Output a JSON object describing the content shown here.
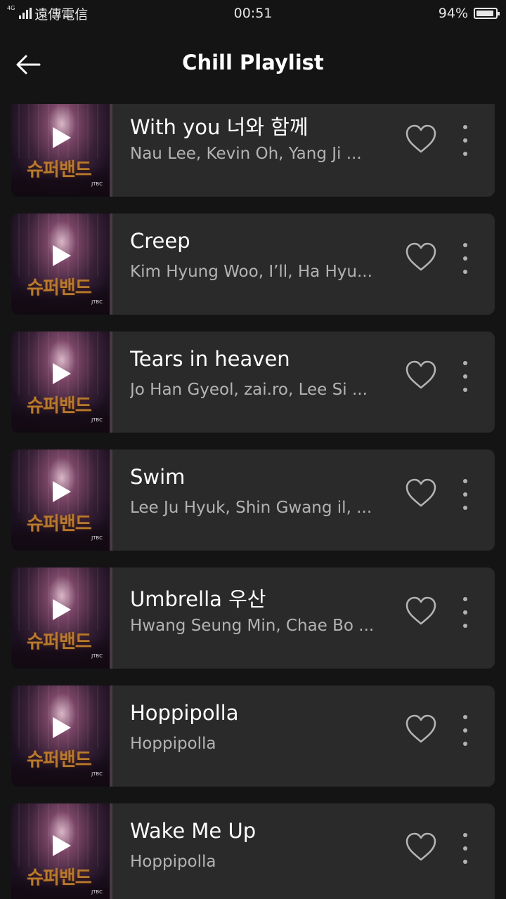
{
  "status_bar": {
    "network_tag": "4G",
    "carrier": "遠傳電信",
    "time": "00:51",
    "battery_percent": "94%",
    "battery_level": 0.94
  },
  "header": {
    "title": "Chill Playlist",
    "back_icon": "arrow-left-icon"
  },
  "cover_art": {
    "logo_text": "슈퍼밴드",
    "tag_text": "JTBC"
  },
  "tracks": [
    {
      "title": "With you 너와 함께",
      "artists": "Nau Lee, Kevin Oh, Yang Ji ..."
    },
    {
      "title": "Creep",
      "artists": "Kim Hyung Woo, I’ll, Ha Hyu..."
    },
    {
      "title": "Tears in heaven",
      "artists": "Jo Han Gyeol, zai.ro, Lee Si ..."
    },
    {
      "title": "Swim",
      "artists": "Lee Ju Hyuk, Shin Gwang il, ..."
    },
    {
      "title": "Umbrella 우산",
      "artists": "Hwang Seung Min, Chae Bo ..."
    },
    {
      "title": "Hoppipolla",
      "artists": "Hoppipolla"
    },
    {
      "title": "Wake Me Up",
      "artists": "Hoppipolla"
    }
  ],
  "icons": {
    "like": "heart-outline-icon",
    "more": "more-vertical-icon",
    "play": "play-icon"
  },
  "colors": {
    "background": "#141414",
    "card": "#2a2a2a",
    "primary_text": "#ffffff",
    "secondary_text": "#b3b3b3"
  }
}
